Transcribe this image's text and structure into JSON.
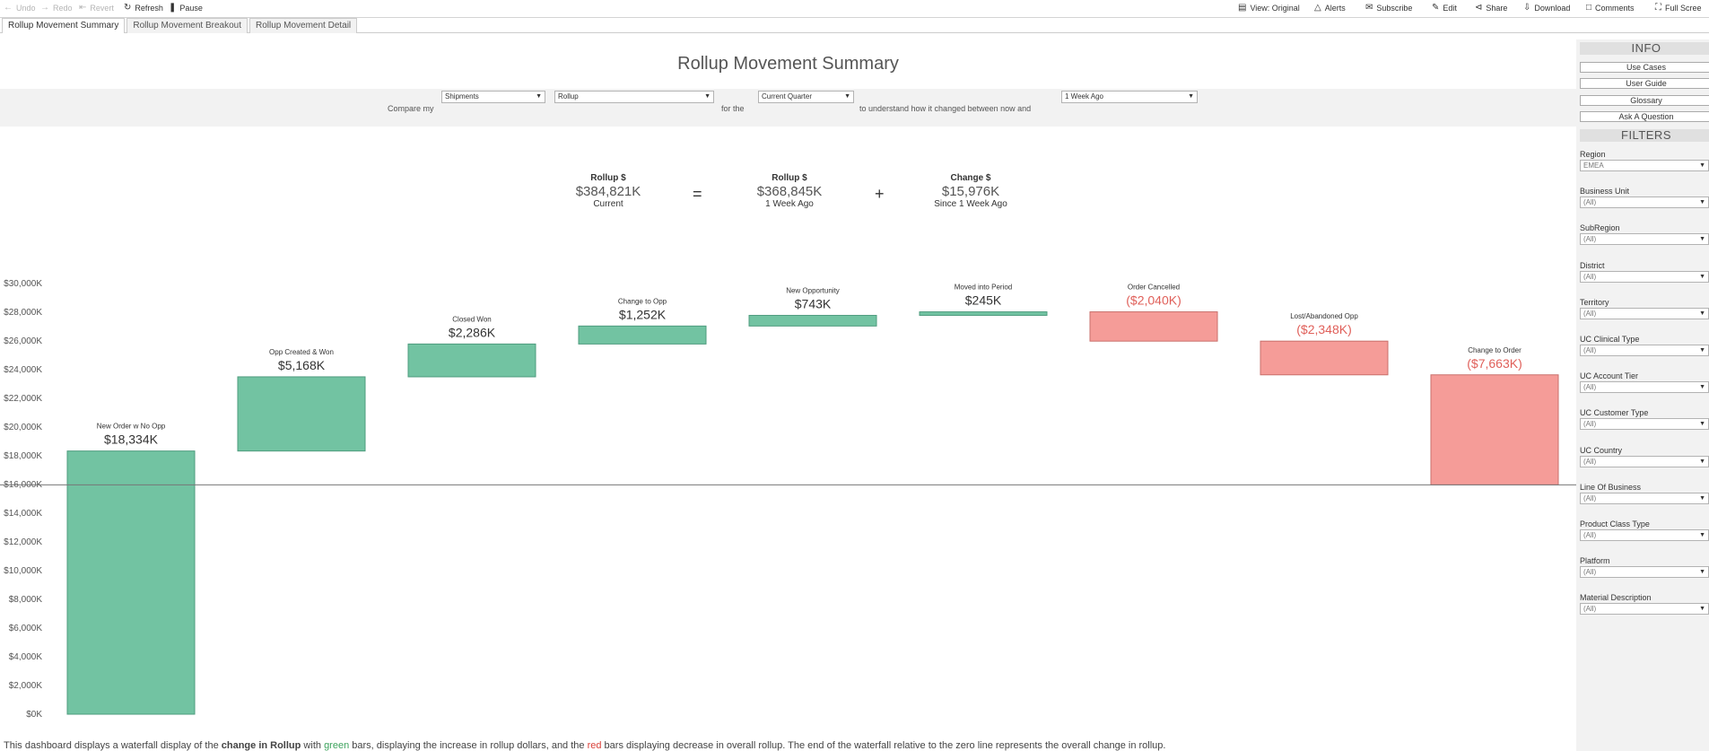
{
  "toolbar": {
    "undo": "Undo",
    "redo": "Redo",
    "revert": "Revert",
    "refresh": "Refresh",
    "pause": "Pause",
    "view_original": "View: Original",
    "alerts": "Alerts",
    "subscribe": "Subscribe",
    "edit": "Edit",
    "share": "Share",
    "download": "Download",
    "comments": "Comments",
    "full_screen": "Full Scree"
  },
  "tabs": [
    {
      "label": "Rollup Movement Summary",
      "active": true
    },
    {
      "label": "Rollup Movement Breakout",
      "active": false
    },
    {
      "label": "Rollup Movement Detail",
      "active": false
    }
  ],
  "dashboard": {
    "title": "Rollup Movement Summary",
    "compare": {
      "text_compare": "Compare my",
      "measure": "Shipments",
      "metric": "Rollup",
      "text_for_the": "for the",
      "period": "Current Quarter",
      "text_understand": "to understand how it changed between now and",
      "baseline": "1 Week Ago"
    },
    "kpis": [
      {
        "title": "Rollup $",
        "value": "$384,821K",
        "sub": "Current"
      },
      {
        "title": "Rollup $",
        "value": "$368,845K",
        "sub": "1 Week Ago"
      },
      {
        "title": "Change $",
        "value": "$15,976K",
        "sub": "Since 1 Week Ago"
      }
    ],
    "op_equals": "=",
    "op_plus": "+",
    "description": {
      "p1": "This dashboard displays a waterfall display of the ",
      "b1": "change in Rollup",
      "p2": " with ",
      "green": "green",
      "p3": " bars, displaying the increase in rollup dollars, and the ",
      "red": "red",
      "p4": " bars displaying decrease in overall rollup. The end of the waterfall relative to the zero line represents the overall change in rollup."
    }
  },
  "chart_data": {
    "type": "bar",
    "subtype": "waterfall",
    "categories": [
      "New Order w No Opp",
      "Opp Created & Won",
      "Closed Won",
      "Change to Opp",
      "New Opportunity",
      "Moved into Period",
      "Order Cancelled",
      "Lost/Abandoned Opp",
      "Change to Order"
    ],
    "values": [
      18334,
      5168,
      2286,
      1252,
      743,
      245,
      -2040,
      -2348,
      -7663
    ],
    "value_labels": [
      "$18,334K",
      "$5,168K",
      "$2,286K",
      "$1,252K",
      "$743K",
      "$245K",
      "($2,040K)",
      "($2,348K)",
      "($7,663K)"
    ],
    "ylim": [
      0,
      30000
    ],
    "yticks": [
      "$0K",
      "$2,000K",
      "$4,000K",
      "$6,000K",
      "$8,000K",
      "$10,000K",
      "$12,000K",
      "$14,000K",
      "$16,000K",
      "$18,000K",
      "$20,000K",
      "$22,000K",
      "$24,000K",
      "$26,000K",
      "$28,000K",
      "$30,000K"
    ],
    "reference_line": 15976,
    "colors": {
      "increase": "#72c3a2",
      "decrease": "#f59c98",
      "increase_label": "#333333",
      "decrease_label": "#e0605a"
    }
  },
  "side": {
    "info_header": "INFO",
    "info_buttons": [
      "Use Cases",
      "User Guide",
      "Glossary",
      "Ask A Question"
    ],
    "filters_header": "FILTERS",
    "filters": [
      {
        "label": "Region",
        "value": "EMEA"
      },
      {
        "label": "Business Unit",
        "value": "(All)"
      },
      {
        "label": "SubRegion",
        "value": "(All)"
      },
      {
        "label": "District",
        "value": "(All)"
      },
      {
        "label": "Territory",
        "value": "(All)"
      },
      {
        "label": "UC Clinical Type",
        "value": "(All)"
      },
      {
        "label": "UC Account Tier",
        "value": "(All)"
      },
      {
        "label": "UC Customer Type",
        "value": "(All)"
      },
      {
        "label": "UC Country",
        "value": "(All)"
      },
      {
        "label": "Line Of Business",
        "value": "(All)"
      },
      {
        "label": "Product Class Type",
        "value": "(All)"
      },
      {
        "label": "Platform",
        "value": "(All)"
      },
      {
        "label": "Material Description",
        "value": "(All)"
      }
    ]
  }
}
